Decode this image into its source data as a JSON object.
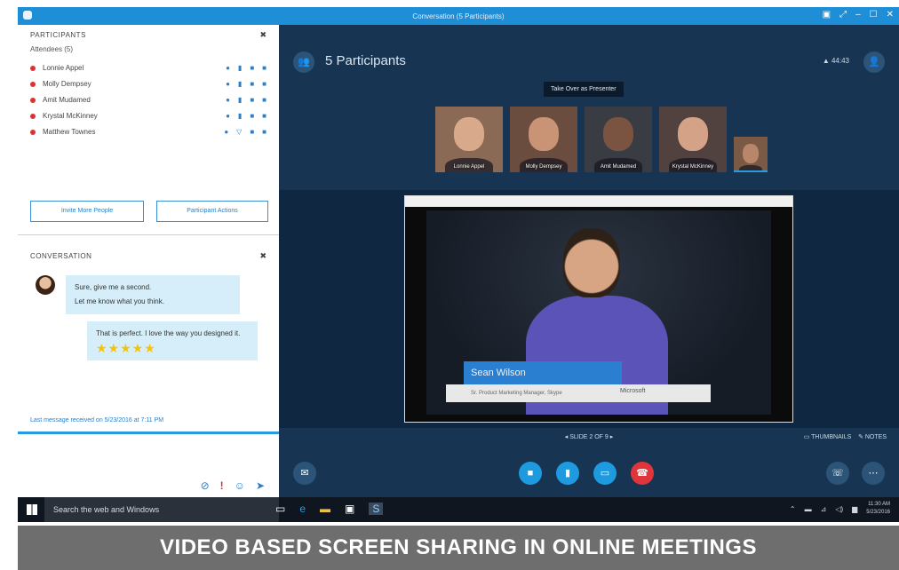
{
  "window": {
    "title": "Conversation (5 Participants)",
    "controls": [
      "▣",
      "⤢",
      "–",
      "☐",
      "✕"
    ]
  },
  "participants_panel": {
    "header": "PARTICIPANTS",
    "attendees_label": "Attendees (5)",
    "people": [
      {
        "name": "Lonnie Appel"
      },
      {
        "name": "Molly Dempsey"
      },
      {
        "name": "Amit Mudamed"
      },
      {
        "name": "Krystal McKinney"
      },
      {
        "name": "Matthew Townes"
      }
    ],
    "invite_button": "Invite More People",
    "actions_button": "Participant Actions"
  },
  "conversation": {
    "header": "CONVERSATION",
    "incoming": [
      "Sure, give me a second.",
      "Let me know what you think."
    ],
    "outgoing_text": "That is perfect. I love the way you designed it.",
    "outgoing_stars": "★★★★★",
    "last_message": "Last message received on 5/23/2016 at 7:11 PM"
  },
  "stage": {
    "participants_count_label": "5 Participants",
    "signal_label": "44:43",
    "tooltip": "Take Over as Presenter",
    "thumbnails": [
      {
        "name": "Lonnie Appel",
        "bg": "#8a6a55",
        "face": "#d8a98a"
      },
      {
        "name": "Molly Dempsey",
        "bg": "#6a4d3e",
        "face": "#c99376"
      },
      {
        "name": "Amit Mudamed",
        "bg": "#3a3c44",
        "face": "#7a5440"
      },
      {
        "name": "Krystal McKinney",
        "bg": "#51423f",
        "face": "#d3a287"
      },
      {
        "name": "",
        "bg": "#7a5a44",
        "face": "#b8866a"
      }
    ],
    "presenter_name": "Sean Wilson",
    "presenter_role": "Sr. Product Marketing Manager, Skype",
    "lower_third_logo": "Microsoft",
    "slide_label": "◂  SLIDE 2 OF 9  ▸",
    "thumbnails_label": "▭ THUMBNAILS",
    "notes_label": "✎ NOTES"
  },
  "taskbar": {
    "search_placeholder": "Search the web and Windows",
    "time": "11:30 AM",
    "date": "5/23/2016"
  },
  "caption": "VIDEO BASED SCREEN SHARING IN ONLINE MEETINGS",
  "colors": {
    "accent": "#1e9be0",
    "stage_bg": "#173552",
    "end_call": "#e0353a",
    "presence_busy": "#e03030"
  }
}
